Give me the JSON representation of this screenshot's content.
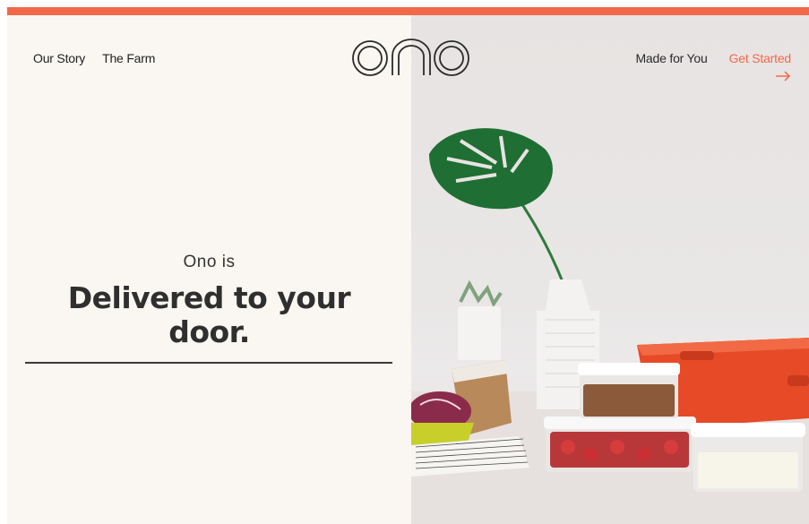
{
  "brand": {
    "logo_text": "ono",
    "accent_color": "#f2694a"
  },
  "nav": {
    "left_links": [
      "Our Story",
      "The Farm"
    ],
    "right_link": "Made for You",
    "cta_label": "Get Started",
    "cta_icon": "arrow-right-icon"
  },
  "hero": {
    "intro": "Ono is",
    "title_line1": "Delivered to your",
    "title_line2": "door."
  },
  "image": {
    "description_icons": [
      "monstera-leaf",
      "vase",
      "succulent-pot",
      "radicchio-bowl",
      "food-containers",
      "orange-crate"
    ]
  }
}
